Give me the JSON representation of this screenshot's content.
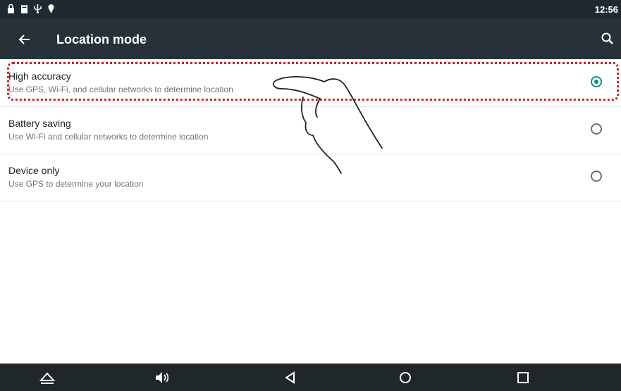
{
  "status_bar": {
    "time": "12:56",
    "icons": [
      "lock-icon",
      "sd-card-icon",
      "usb-icon",
      "location-pin-icon"
    ]
  },
  "app_bar": {
    "title": "Location mode",
    "back_icon": "arrow-back-icon",
    "search_icon": "search-icon"
  },
  "options": [
    {
      "title": "High accuracy",
      "description": "Use GPS, Wi-Fi, and cellular networks to determine location",
      "selected": true
    },
    {
      "title": "Battery saving",
      "description": "Use Wi-Fi and cellular networks to determine location",
      "selected": false
    },
    {
      "title": "Device only",
      "description": "Use GPS to determine your location",
      "selected": false
    }
  ],
  "nav_bar": {
    "icons": [
      "eject-icon",
      "volume-icon",
      "back-triangle-icon",
      "home-circle-icon",
      "recents-square-icon"
    ]
  },
  "colors": {
    "app_bar": "#263238",
    "status_bar": "#1f2a30",
    "nav_bar": "#20272b",
    "accent": "#009688",
    "highlight": "#d22020"
  }
}
